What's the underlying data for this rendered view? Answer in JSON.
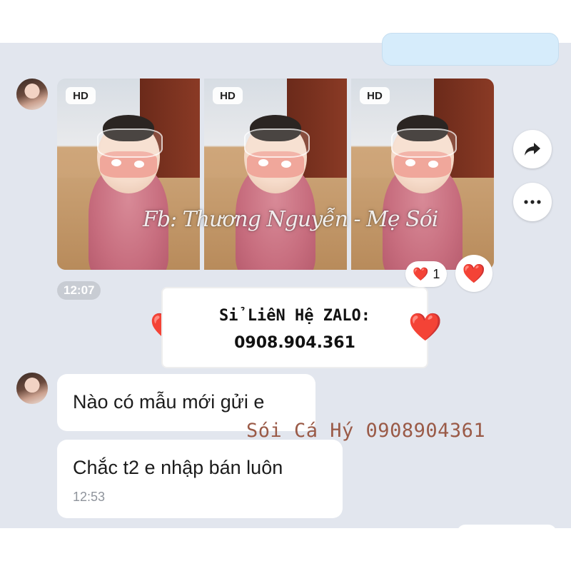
{
  "photos": [
    {
      "badge": "HD"
    },
    {
      "badge": "HD"
    },
    {
      "badge": "HD"
    }
  ],
  "watermark": "Fb: Thương Nguyễn - Mẹ Sói",
  "photo_time": "12:07",
  "reaction": {
    "emoji": "❤️",
    "count": "1"
  },
  "react_button_emoji": "❤️",
  "share_icon": "share-arrow-icon",
  "more_icon": "more-dots-icon",
  "overlay": {
    "line1": "Sỉ LiêN Hệ ZALO:",
    "line2": "0908.904.361",
    "heart": "❤️"
  },
  "messages": [
    {
      "text": "Nào có mẫu mới gửi e"
    },
    {
      "text": "Chắc t2 e nhập bán luôn",
      "time": "12:53"
    }
  ],
  "signature": "Sói Cá Hý 0908904361",
  "colors": {
    "chat_bg": "#e2e6ee",
    "bubble": "#ffffff",
    "sent_bubble": "#d6ecfb",
    "heart": "#d81a22",
    "signature": "#9a5a47"
  }
}
